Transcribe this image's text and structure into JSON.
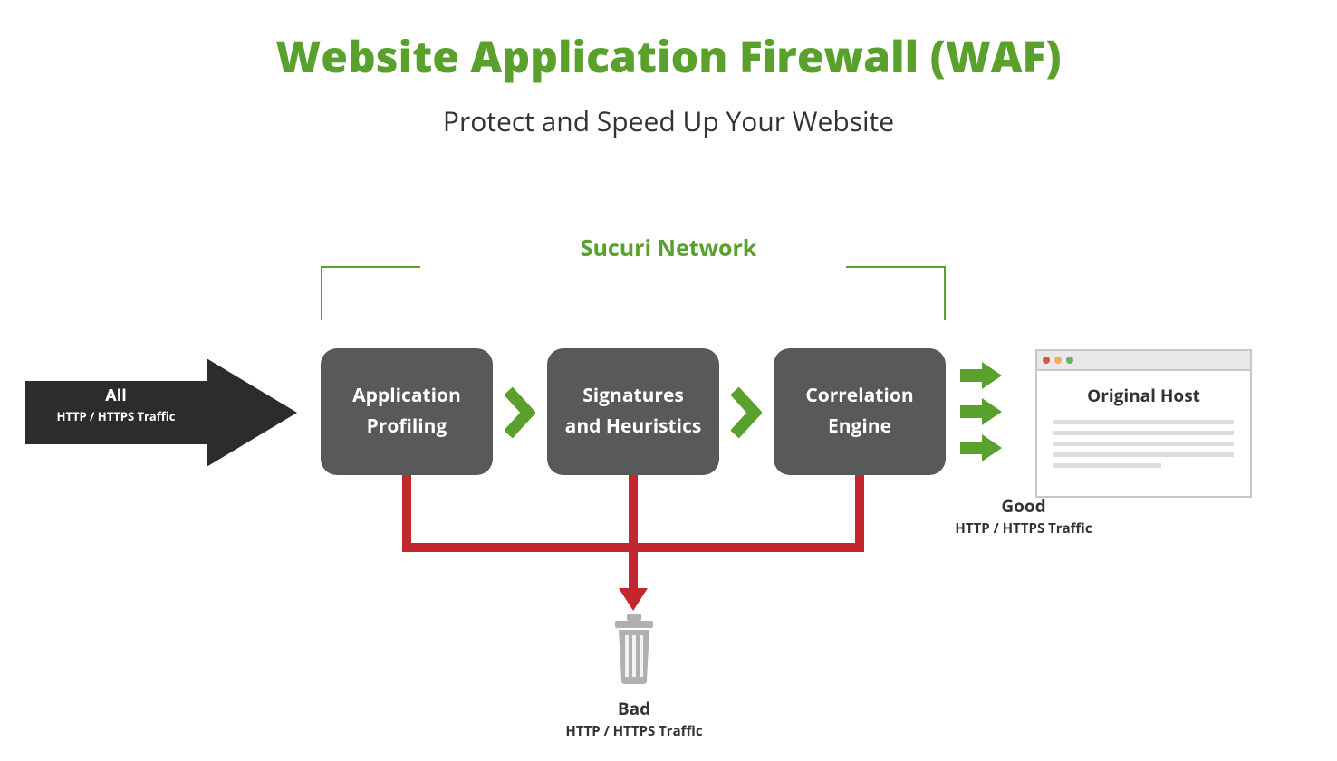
{
  "title": "Website Application Firewall (WAF)",
  "subtitle": "Protect and Speed Up Your Website",
  "network_label": "Sucuri Network",
  "incoming": {
    "line1": "All",
    "line2": "HTTP / HTTPS Traffic"
  },
  "nodes": {
    "n1": {
      "line1": "Application",
      "line2": "Profiling"
    },
    "n2": {
      "line1": "Signatures",
      "line2": "and Heuristics"
    },
    "n3": {
      "line1": "Correlation",
      "line2": "Engine"
    }
  },
  "good": {
    "line1": "Good",
    "line2": "HTTP / HTTPS Traffic"
  },
  "bad": {
    "line1": "Bad",
    "line2": "HTTP / HTTPS Traffic"
  },
  "host_title": "Original Host",
  "colors": {
    "green": "#5aa02c",
    "gray_box": "#58595b",
    "red": "#c1272d",
    "black_arrow": "#2b2c2d"
  }
}
